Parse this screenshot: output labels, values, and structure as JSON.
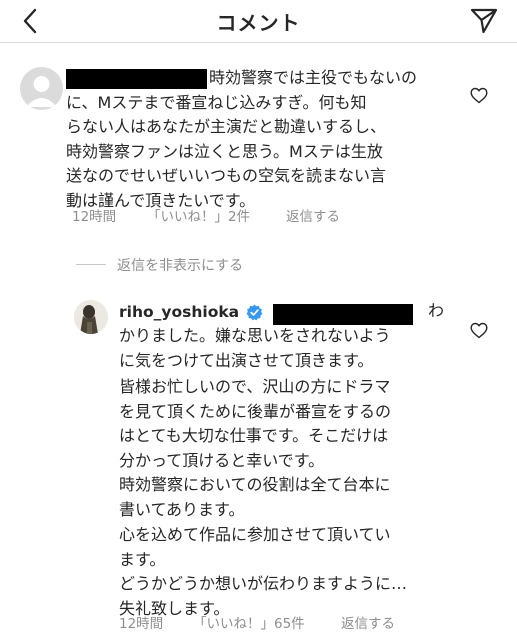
{
  "header": {
    "title": "コメント",
    "back_icon": "chevron-left-icon",
    "send_icon": "paper-plane-icon"
  },
  "comment": {
    "lines": [
      "時効警察では主役でもないの",
      "に、Mステまで番宣ねじ込みすぎ。何も知",
      "らない人はあなたが主演だと勘違いするし、",
      "時効警察ファンは泣くと思う。Mステは生放",
      "送なのでせいぜいいつもの空気を読まない言",
      "動は謹んで頂きたいです。"
    ],
    "time": "12時間",
    "likes": "「いいね！」2件",
    "reply": "返信する"
  },
  "hide_replies": "返信を非表示にする",
  "reply_comment": {
    "username": "riho_yoshioka",
    "lines_first": [
      "わ",
      "かりました。嫌な思いをされないよう",
      "に気をつけて出演させて頂きます。"
    ],
    "paragraphs": [
      [
        "皆様お忙しいので、沢山の方にドラマ",
        "を見て頂くために後輩が番宣をするの",
        "はとても大切な仕事です。そこだけは",
        "分かって頂けると幸いです。"
      ],
      [
        "時効警察においての役割は全て台本に",
        "書いてあります。"
      ],
      [
        "心を込めて作品に参加させて頂いてい",
        "ます。"
      ],
      [
        "どうかどうか想いが伝わりますように…",
        "失礼致します。"
      ]
    ],
    "time": "12時間",
    "likes": "「いいね！」65件",
    "reply": "返信する"
  },
  "colors": {
    "text": "#262626",
    "secondary": "#8e8e8e",
    "verified": "#3897f0",
    "divider": "#dbdbdb"
  }
}
